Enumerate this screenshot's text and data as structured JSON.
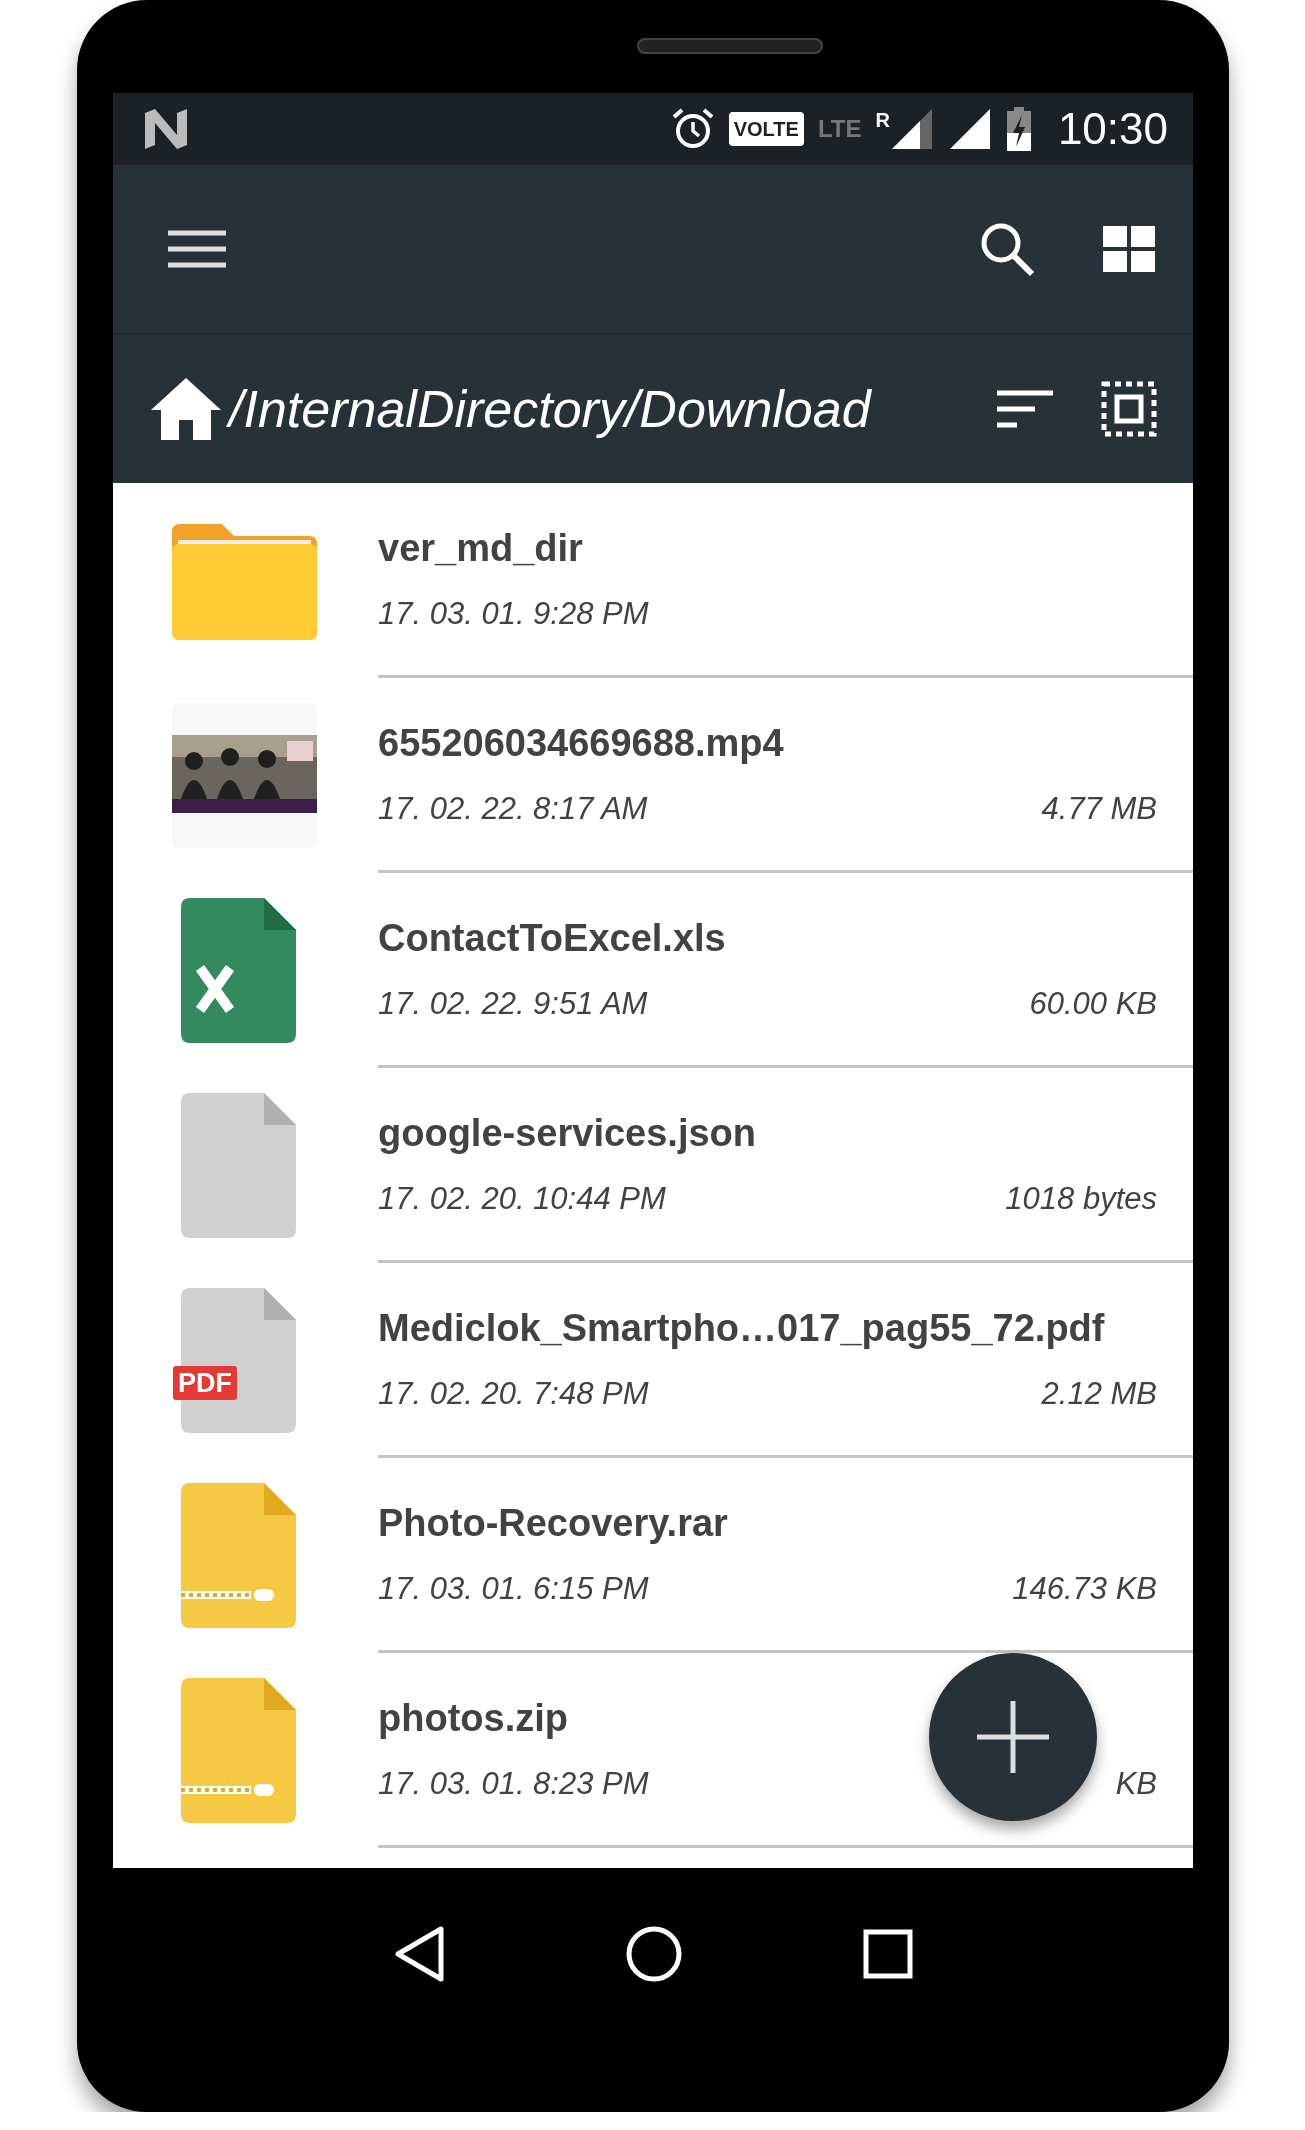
{
  "status_bar": {
    "volte": "VOLTE",
    "lte": "LTE",
    "roaming": "R",
    "time": "10:30"
  },
  "path": "/InternalDirectory/Download",
  "files": [
    {
      "kind": "folder",
      "name": "ver_md_dir",
      "date": "17. 03. 01. 9:28 PM"
    },
    {
      "kind": "video",
      "name": "655206034669688.mp4",
      "date": "17. 02. 22. 8:17 AM",
      "size": "4.77 MB"
    },
    {
      "kind": "excel",
      "name": "ContactToExcel.xls",
      "date": "17. 02. 22. 9:51 AM",
      "size": "60.00 KB"
    },
    {
      "kind": "file",
      "name": "google-services.json",
      "date": "17. 02. 20. 10:44 PM",
      "size": "1018 bytes"
    },
    {
      "kind": "pdf",
      "name": "Mediclok_Smartpho…017_pag55_72.pdf",
      "date": "17. 02. 20. 7:48 PM",
      "size": "2.12 MB",
      "badge": "PDF"
    },
    {
      "kind": "archive",
      "name": "Photo-Recovery.rar",
      "date": "17. 03. 01. 6:15 PM",
      "size": "146.73 KB"
    },
    {
      "kind": "archive",
      "name": "photos.zip",
      "date": "17. 03. 01. 8:23 PM",
      "size": "KB"
    }
  ]
}
